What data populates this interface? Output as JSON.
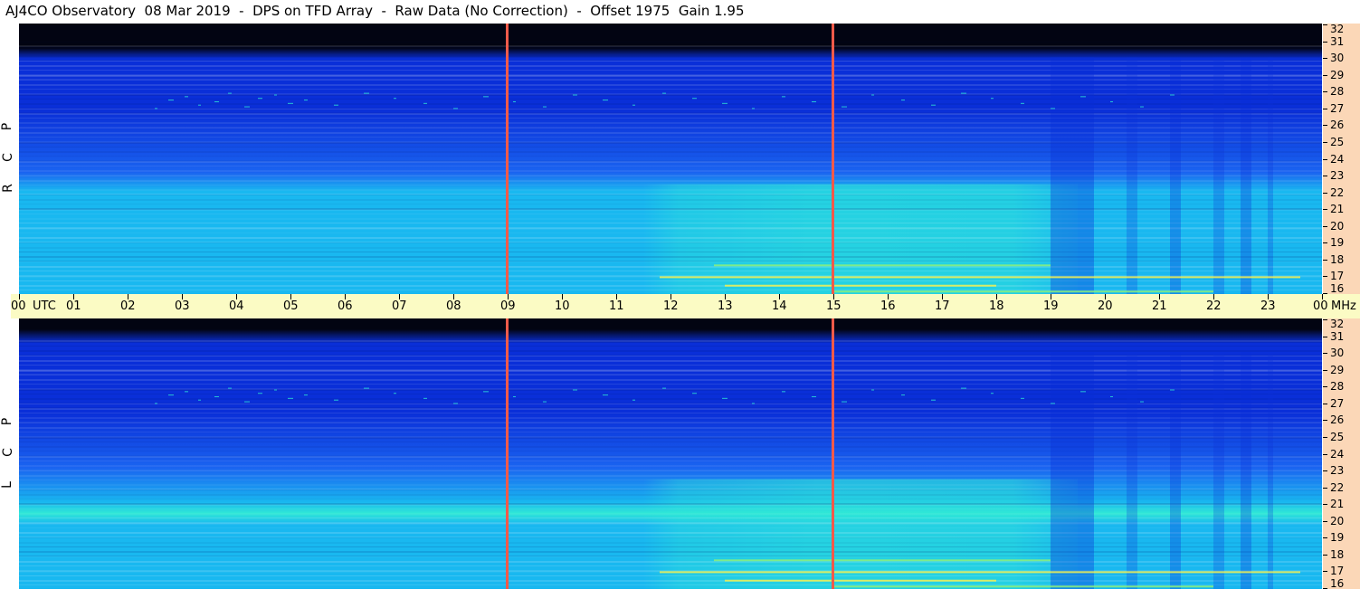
{
  "title": "AJ4CO Observatory  08 Mar 2019  -  DPS on TFD Array  -  Raw Data (No Correction)  -  Offset 1975  Gain 1.95",
  "panels": [
    {
      "id": "rcp",
      "letters": [
        "R",
        "C",
        "P"
      ]
    },
    {
      "id": "lcp",
      "letters": [
        "L",
        "C",
        "P"
      ]
    }
  ],
  "time_axis": {
    "labels": [
      "00",
      "01",
      "02",
      "03",
      "04",
      "05",
      "06",
      "07",
      "08",
      "09",
      "10",
      "11",
      "12",
      "13",
      "14",
      "15",
      "16",
      "17",
      "18",
      "19",
      "20",
      "21",
      "22",
      "23",
      "00"
    ],
    "unit_label": "UTC",
    "freq_unit": "MHz"
  },
  "freq_axis": {
    "labels": [
      "32",
      "31",
      "30",
      "29",
      "28",
      "27",
      "26",
      "25",
      "24",
      "23",
      "22",
      "21",
      "20",
      "19",
      "18",
      "17",
      "16"
    ]
  },
  "colors": {
    "dark": "#020412",
    "deep_blue": "#0a2fd8",
    "blue": "#1a63f0",
    "cyan": "#19b8f0",
    "aqua": "#2fe8d6",
    "green": "#8ef07a",
    "yellow": "#f4f050",
    "marker_red": "#f05a4a",
    "time_axis_bg": "#fbfbc4",
    "freq_axis_bg": "#fbd7b7"
  },
  "chart_data": {
    "type": "heatmap",
    "x_range_utc_hours": [
      0,
      24
    ],
    "y_range_mhz": [
      16,
      32
    ],
    "markers_utc_hours": [
      9,
      15
    ],
    "series": [
      {
        "name": "RCP"
      },
      {
        "name": "LCP"
      }
    ]
  }
}
